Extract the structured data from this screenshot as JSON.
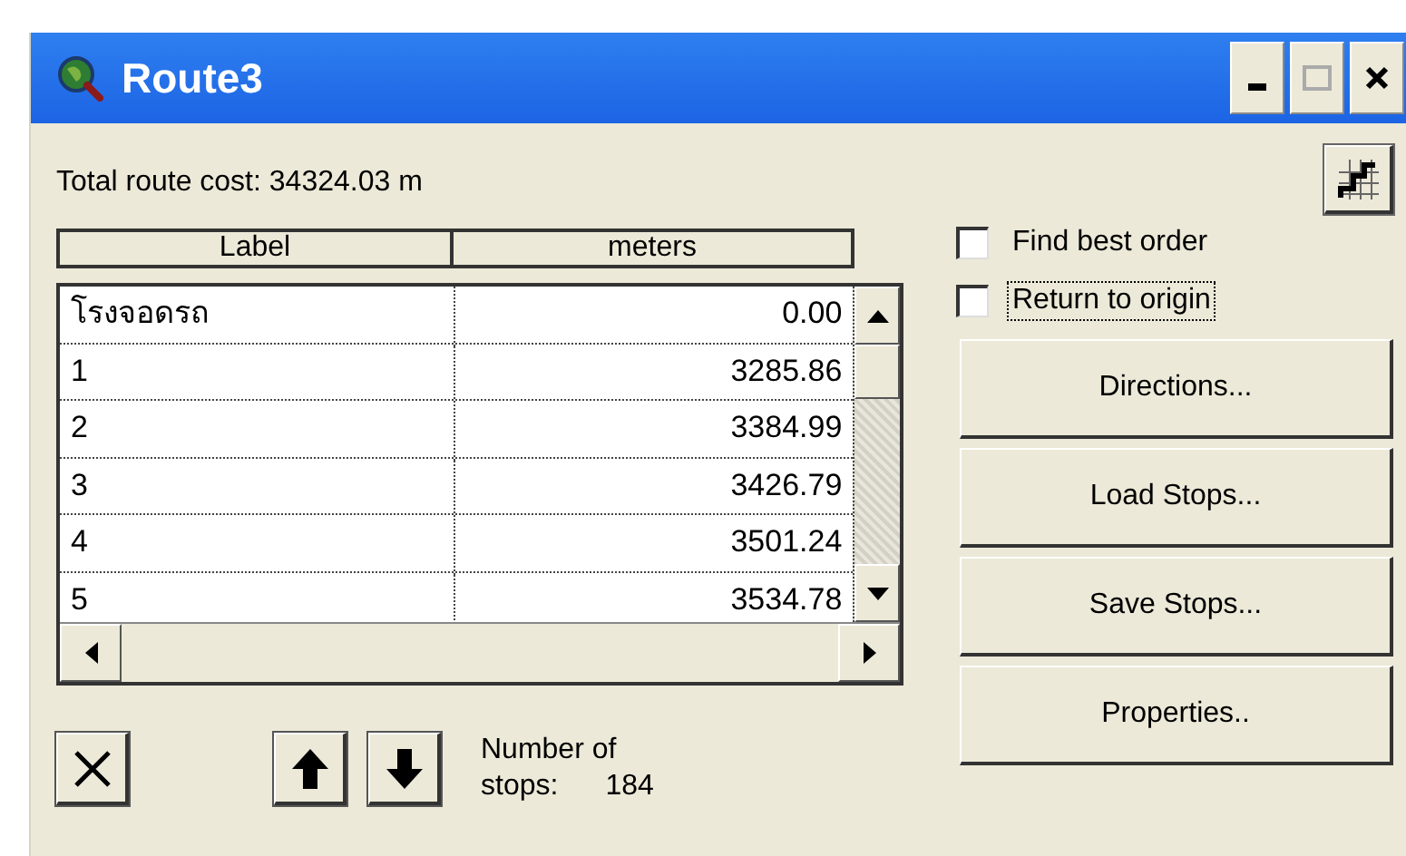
{
  "window": {
    "title": "Route3"
  },
  "total_cost": "Total route cost: 34324.03 m",
  "table": {
    "columns": [
      "Label",
      "meters"
    ],
    "rows": [
      {
        "label": "โรงจอดรถ",
        "meters": "0.00"
      },
      {
        "label": "1",
        "meters": "3285.86"
      },
      {
        "label": "2",
        "meters": "3384.99"
      },
      {
        "label": "3",
        "meters": "3426.79"
      },
      {
        "label": "4",
        "meters": "3501.24"
      },
      {
        "label": "5",
        "meters": "3534.78"
      }
    ]
  },
  "options": [
    {
      "label": "Find best order",
      "checked": false,
      "focused": false
    },
    {
      "label": "Return to origin",
      "checked": false,
      "focused": true
    }
  ],
  "buttons": [
    "Directions...",
    "Load Stops...",
    "Save Stops...",
    "Properties.."
  ],
  "stops": {
    "label": "Number of",
    "label_2": "stops:",
    "count": "184"
  }
}
